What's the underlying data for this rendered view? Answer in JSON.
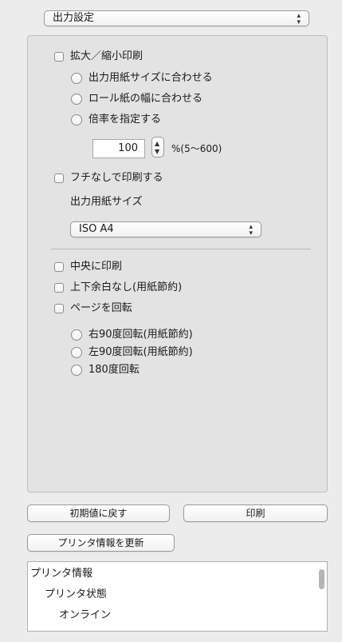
{
  "settings_select": {
    "value": "出力設定"
  },
  "scaling": {
    "checkbox_label": "拡大／縮小印刷",
    "options": [
      "出力用紙サイズに合わせる",
      "ロール紙の幅に合わせる",
      "倍率を指定する"
    ],
    "percent_value": "100",
    "percent_range": "%(5〜600)"
  },
  "borderless": {
    "checkbox_label": "フチなしで印刷する",
    "paper_size_label": "出力用紙サイズ",
    "paper_size_value": "ISO A4"
  },
  "layout": {
    "center_label": "中央に印刷",
    "no_margin_label": "上下余白なし(用紙節約)",
    "rotate_label": "ページを回転",
    "rotate_options": [
      "右90度回転(用紙節約)",
      "左90度回転(用紙節約)",
      "180度回転"
    ]
  },
  "buttons": {
    "reset": "初期値に戻す",
    "print": "印刷",
    "update_printer_info": "プリンタ情報を更新"
  },
  "printer_info": {
    "root": "プリンタ情報",
    "status_label": "プリンタ状態",
    "status_value": "オンライン"
  }
}
